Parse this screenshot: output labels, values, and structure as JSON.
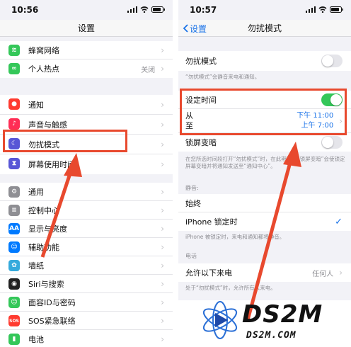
{
  "left": {
    "status": {
      "time": "10:56"
    },
    "title": "设置",
    "group1": [
      {
        "label": "蜂窝网络",
        "icon": "cellular-icon",
        "color": "#34c759",
        "glyph": "((•))"
      },
      {
        "label": "个人热点",
        "value": "关闭",
        "icon": "hotspot-icon",
        "color": "#34c759",
        "glyph": "∞"
      }
    ],
    "group2": [
      {
        "label": "通知",
        "icon": "notifications-icon",
        "color": "#ff3b30",
        "glyph": "●"
      },
      {
        "label": "声音与触感",
        "icon": "sound-icon",
        "color": "#ff2d55",
        "glyph": "♪"
      },
      {
        "label": "勿扰模式",
        "icon": "moon-icon",
        "color": "#5856d6",
        "glyph": "☾"
      },
      {
        "label": "屏幕使用时间",
        "icon": "hourglass-icon",
        "color": "#5856d6",
        "glyph": "⧗"
      }
    ],
    "group3": [
      {
        "label": "通用",
        "icon": "gear-icon",
        "color": "#8e8e93",
        "glyph": "⚙"
      },
      {
        "label": "控制中心",
        "icon": "control-center-icon",
        "color": "#8e8e93",
        "glyph": "≡"
      },
      {
        "label": "显示与亮度",
        "icon": "display-icon",
        "color": "#007aff",
        "glyph": "AA"
      },
      {
        "label": "辅助功能",
        "icon": "accessibility-icon",
        "color": "#007aff",
        "glyph": "☺"
      },
      {
        "label": "墙纸",
        "icon": "wallpaper-icon",
        "color": "#35aadc",
        "glyph": "✿"
      },
      {
        "label": "Siri与搜索",
        "icon": "siri-icon",
        "color": "#222",
        "glyph": "◉"
      },
      {
        "label": "面容ID与密码",
        "icon": "faceid-icon",
        "color": "#34c759",
        "glyph": "☺"
      },
      {
        "label": "SOS紧急联络",
        "icon": "sos-icon",
        "color": "#ff3b30",
        "glyph": "SOS"
      },
      {
        "label": "电池",
        "icon": "battery-icon",
        "color": "#34c759",
        "glyph": "▮"
      }
    ]
  },
  "right": {
    "status": {
      "time": "10:57"
    },
    "back": "设置",
    "title": "勿扰模式",
    "dnd_label": "勿扰模式",
    "dnd_note": "“勿扰模式”会静音来电和通知。",
    "scheduled_label": "设定时间",
    "from_label": "从",
    "to_label": "至",
    "from_value": "下午 11:00",
    "to_value": "上午 7:00",
    "dim_label": "锁屏变暗",
    "dim_note": "在您所选时间段打开“勿扰模式”时，在此期间，“锁屏变暗”会使锁定屏幕变暗并将通知发送至“通知中心”。",
    "silence_header": "静音:",
    "always_label": "始终",
    "locked_label": "iPhone 锁定时",
    "locked_note": "iPhone 被锁定时，来电和通知都将静音。",
    "phone_header": "电话",
    "allow_label": "允许以下来电",
    "allow_value": "任何人",
    "allow_note": "处于“勿扰模式”时，允许所有人来电。"
  },
  "watermark": {
    "big": "DS2M",
    "small": "DS2M.COM"
  }
}
